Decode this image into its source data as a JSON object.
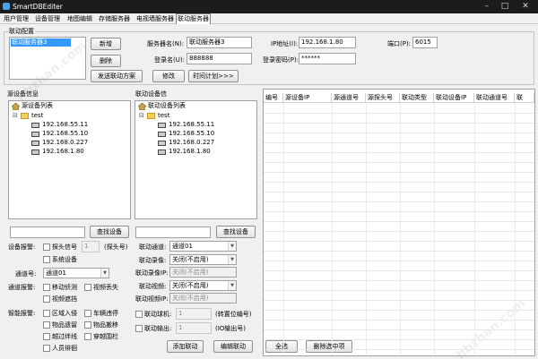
{
  "window": {
    "title": "SmartDBEditer"
  },
  "menu": [
    "用户管理",
    "设备管理",
    "地图编辑",
    "存储服务器",
    "电视墙服务器",
    "联动服务器"
  ],
  "link_config": {
    "group_label": "联动配置",
    "list_items": [
      "联动服务器3"
    ],
    "add_button": "新增",
    "delete_button": "删除",
    "send_plan_button": "发送联动方案",
    "server_name_label": "服务器名(N):",
    "server_name_value": "联动服务器3",
    "ip_label": "IP地址(I):",
    "ip_value": "192.168.1.80",
    "port_label": "端口(P):",
    "port_value": "6015",
    "login_name_label": "登录名(U):",
    "login_name_value": "888888",
    "login_pwd_label": "登录密码(P):",
    "login_pwd_value": "******",
    "modify_button": "修改",
    "schedule_button": "时间计划>>>"
  },
  "source_panel": {
    "group_label": "源设备信息",
    "tree_root": "源设备列表",
    "tree_folder": "test",
    "tree_devices": [
      "192.168.55.11",
      "192.168.55.10",
      "192.168.0.227",
      "192.168.1.80"
    ],
    "search_value": "",
    "search_button": "查找设备",
    "device_alarm_label": "设备报警:",
    "probe_signal_label": "探头信号",
    "probe_number_value": "1",
    "probe_number_suffix": "(探头号)",
    "system_device_label": "系统设备",
    "channel_label": "通道号:",
    "channel_value": "通道01",
    "channel_alarm_label": "通道报警:",
    "motion_detect_label": "移动侦测",
    "video_loss_label": "视频丢失",
    "video_mask_label": "视频遮挡",
    "smart_alarm_label": "智能报警:",
    "area_intrusion_label": "区域入侵",
    "vehicle_parking_label": "车辆违停",
    "object_left_label": "物品遗留",
    "object_moved_label": "物品搬移",
    "tripwire_label": "越过绊线",
    "cross_fence_label": "穿越围栏",
    "loitering_label": "人员徘徊"
  },
  "linked_panel": {
    "group_label": "联动设备信",
    "tree_root": "联动设备列表",
    "tree_folder": "test",
    "tree_devices": [
      "192.168.55.11",
      "192.168.55.10",
      "192.168.0.227",
      "192.168.1.80"
    ],
    "search_value": "",
    "search_button": "查找设备",
    "link_channel_label": "联动通道:",
    "link_channel_value": "通道01",
    "link_record_label": "联动录像:",
    "link_record_value": "关闭(不启用)",
    "link_record_ip_label": "联动录像IP:",
    "link_record_ip_value": "关闭(不启用)",
    "link_video_label": "联动视频:",
    "link_video_value": "关闭(不启用)",
    "link_video_ip_label": "联动视频IP:",
    "link_video_ip_value": "关闭(不启用)",
    "link_ptz_label": "联动球机:",
    "link_ptz_value": "1",
    "link_ptz_suffix": "(转置位编号)",
    "link_output_label": "联动输出:",
    "link_output_value": "1",
    "link_output_suffix": "(IO输出号)",
    "add_link_button": "添加联动",
    "edit_link_button": "编辑联动"
  },
  "grid": {
    "columns": [
      "编号",
      "源设备IP",
      "源通道号",
      "源探头号",
      "联动类型",
      "联动设备IP",
      "联动通道号",
      "联"
    ],
    "select_all_button": "全选",
    "delete_selected_button": "删除选中项"
  },
  "watermark": "hbzhan.com"
}
